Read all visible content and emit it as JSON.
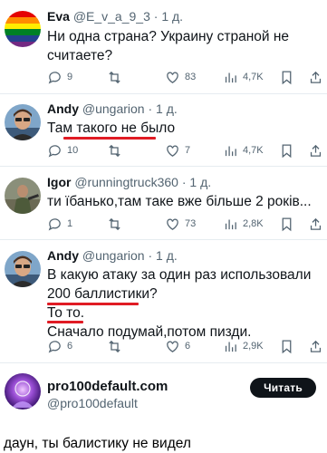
{
  "tweets": [
    {
      "name": "Eva",
      "handle": "@E_v_a_9_3",
      "time": "· 1 д.",
      "text": "Ни одна страна? Украину страной не считаете?",
      "replies": "9",
      "likes": "83",
      "views": "4,7K"
    },
    {
      "name": "Andy",
      "handle": "@ungarion",
      "time": "· 1 д.",
      "text": "Там такого не было",
      "replies": "10",
      "likes": "7",
      "views": "4,7K"
    },
    {
      "name": "Igor",
      "handle": "@runningtruck360",
      "time": "· 1 д.",
      "text": "ти їбанько,там таке вже більше 2 років...",
      "replies": "1",
      "likes": "73",
      "views": "2,8K"
    },
    {
      "name": "Andy",
      "handle": "@ungarion",
      "time": "· 1 д.",
      "lines": [
        "В какую атаку за один раз иcпользовали",
        "200 баллистики?",
        "То то.",
        "Сначало подумай,потом пизди."
      ],
      "replies": "6",
      "likes": "6",
      "views": "2,9K"
    }
  ],
  "profile": {
    "name": "pro100default.com",
    "handle": "@pro100default",
    "follow_label": "Читать"
  },
  "caption": "даун, ты балистику не видел",
  "colors": {
    "underline": "#e01b24",
    "text": "#0f1419",
    "muted": "#536471"
  }
}
